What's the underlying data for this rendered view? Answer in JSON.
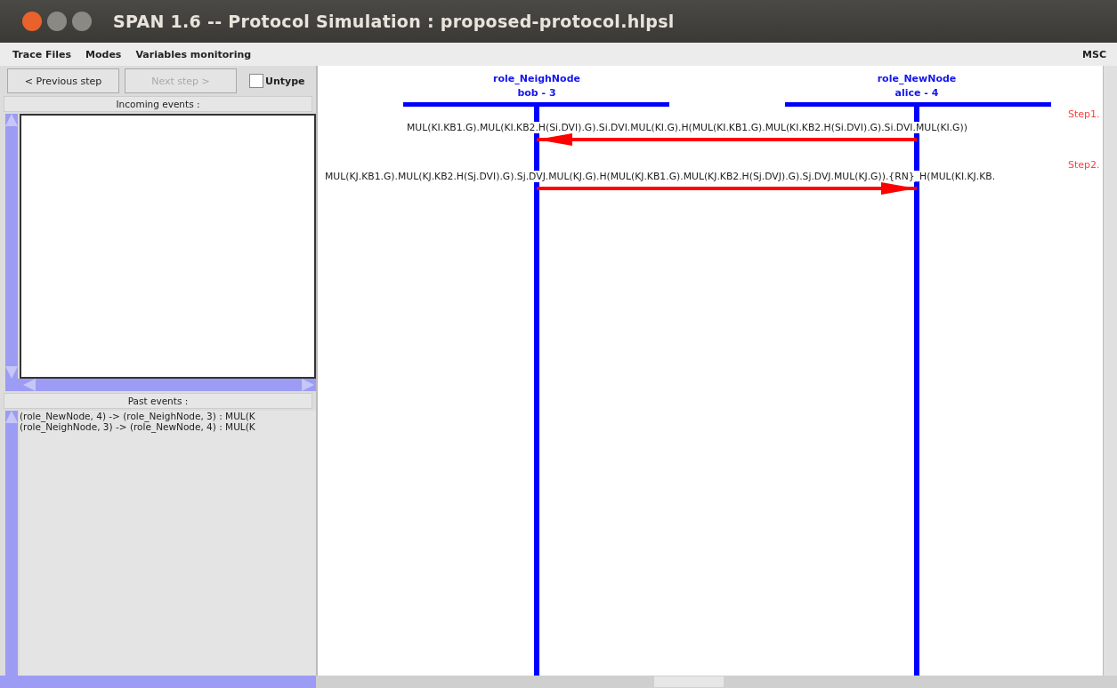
{
  "window": {
    "title": "SPAN 1.6 -- Protocol Simulation : proposed-protocol.hlpsl"
  },
  "menu": {
    "items": [
      "Trace Files",
      "Modes",
      "Variables monitoring"
    ],
    "right_label": "MSC"
  },
  "toolbar": {
    "buttons": [
      {
        "label": "< Previous step",
        "disabled": false
      },
      {
        "label": "Next step >",
        "disabled": true
      }
    ],
    "untype": {
      "label": "Untype",
      "checked": false
    }
  },
  "incoming_events": {
    "title": "Incoming events :"
  },
  "past_events": {
    "title": "Past events :",
    "items": [
      "(role_NewNode, 4) -> (role_NeighNode, 3) : MUL(K",
      "(role_NeighNode, 3) -> (role_NewNode, 4) : MUL(K"
    ]
  },
  "diagram": {
    "roles": [
      {
        "name": "role_NeighNode",
        "instance": "bob - 3"
      },
      {
        "name": "role_NewNode",
        "instance": "alice - 4"
      }
    ],
    "messages": [
      {
        "step": "Step1.",
        "kind": "leftward",
        "text": "MUL(KI.KB1.G).MUL(KI.KB2.H(Si.DVI).G).Si.DVI.MUL(KI.G).H(MUL(KI.KB1.G).MUL(KI.KB2.H(Si.DVI).G).Si.DVI.MUL(KI.G))"
      },
      {
        "step": "Step2.",
        "kind": "rightward",
        "text": "MUL(KJ.KB1.G).MUL(KJ.KB2.H(Sj.DVI).G).Sj.DVJ.MUL(KJ.G).H(MUL(KJ.KB1.G).MUL(KJ.KB2.H(Sj.DVJ).G).Sj.DVJ.MUL(KJ.G)).{RN}_H(MUL(KI.KJ.KB."
      }
    ]
  }
}
